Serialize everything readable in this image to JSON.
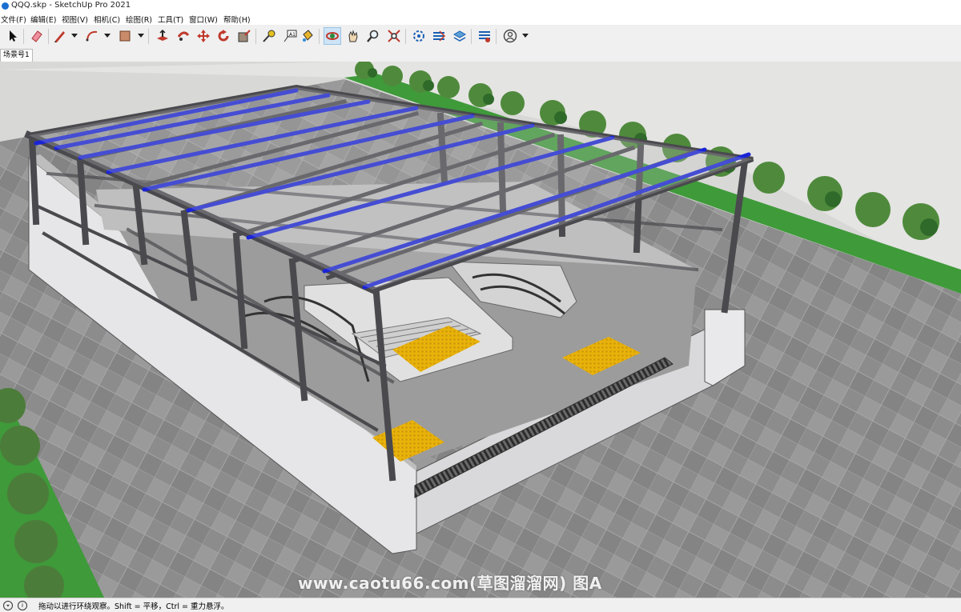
{
  "window": {
    "title": "QQQ.skp - SketchUp Pro 2021"
  },
  "menu": [
    {
      "label": "文件(F)"
    },
    {
      "label": "编辑(E)"
    },
    {
      "label": "视图(V)"
    },
    {
      "label": "相机(C)"
    },
    {
      "label": "绘图(R)"
    },
    {
      "label": "工具(T)"
    },
    {
      "label": "窗口(W)"
    },
    {
      "label": "帮助(H)"
    }
  ],
  "toolbar": {
    "tools": [
      {
        "icon": "select-arrow-icon"
      },
      {
        "icon": "eraser-icon"
      },
      {
        "icon": "pencil-line-icon"
      },
      {
        "icon": "arc-icon"
      },
      {
        "icon": "rectangle-icon"
      },
      {
        "icon": "push-pull-icon"
      },
      {
        "icon": "follow-me-icon"
      },
      {
        "icon": "move-icon"
      },
      {
        "icon": "rotate-icon"
      },
      {
        "icon": "scale-icon"
      },
      {
        "icon": "tape-measure-icon"
      },
      {
        "icon": "text-icon"
      },
      {
        "icon": "paint-bucket-icon"
      },
      {
        "icon": "orbit-icon"
      },
      {
        "icon": "pan-icon"
      },
      {
        "icon": "zoom-icon"
      },
      {
        "icon": "zoom-extents-icon"
      },
      {
        "icon": "warehouse-icon"
      },
      {
        "icon": "extension-warehouse-icon"
      },
      {
        "icon": "layout-icon"
      },
      {
        "icon": "extension-manager-icon"
      },
      {
        "icon": "account-icon"
      }
    ],
    "active_tool": "orbit-icon"
  },
  "scene_tabs": [
    {
      "label": "场景号1"
    }
  ],
  "viewport": {
    "watermark": "www.caotu66.com(草图溜溜网) 图A",
    "colors": {
      "purlin": "#1a24d6",
      "steel": "#4a4a4e",
      "tactile": "#e8b20a",
      "grass": "#3f9a3a",
      "paving": "#8d8d8d"
    }
  },
  "status": {
    "text": "拖动以进行环绕观察。Shift = 平移，Ctrl = 重力悬浮。"
  }
}
